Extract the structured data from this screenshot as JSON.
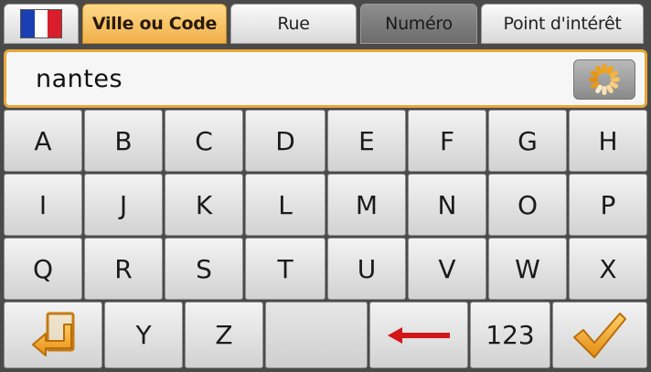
{
  "tabs": {
    "flag_country": "France",
    "flag_colors": [
      "#1a3fb3",
      "#ffffff",
      "#d81e2a"
    ],
    "city": "Ville ou Code",
    "street": "Rue",
    "number": "Numéro",
    "poi": "Point d'intérêt"
  },
  "search": {
    "value": "nantes",
    "spinner_icon": "loading-spinner-icon"
  },
  "keyboard": {
    "row1": [
      "A",
      "B",
      "C",
      "D",
      "E",
      "F",
      "G",
      "H"
    ],
    "row2": [
      "I",
      "J",
      "K",
      "L",
      "M",
      "N",
      "O",
      "P"
    ],
    "row3": [
      "Q",
      "R",
      "S",
      "T",
      "U",
      "V",
      "W",
      "X"
    ],
    "row4": {
      "back_icon": "return-arrow-icon",
      "y": "Y",
      "z": "Z",
      "backspace_icon": "backspace-arrow-icon",
      "numeric": "123",
      "confirm_icon": "checkmark-icon"
    }
  },
  "colors": {
    "accent": "#e8a73a",
    "backspace_arrow": "#d01818"
  }
}
